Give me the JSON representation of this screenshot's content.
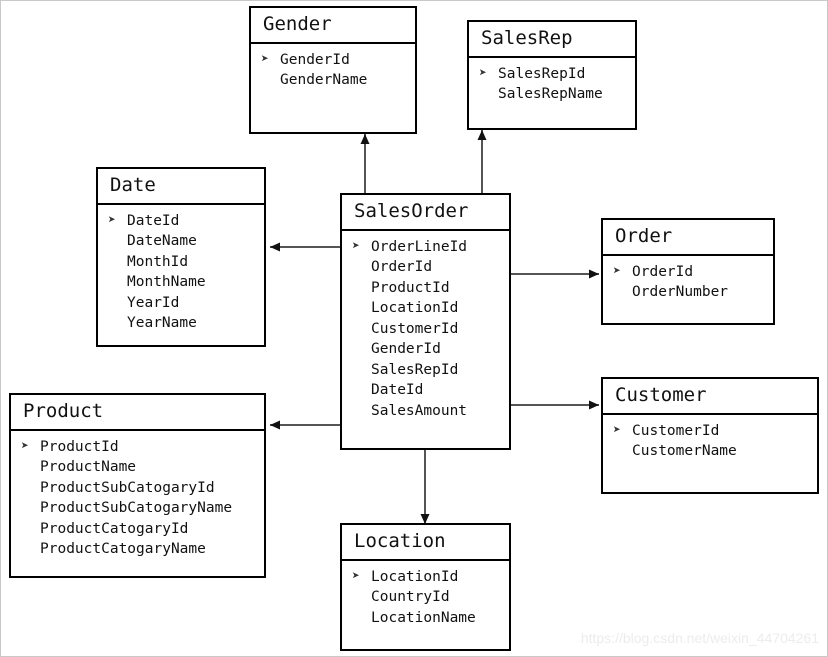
{
  "diagram": {
    "type": "star-schema-erd",
    "watermark": "https://blog.csdn.net/weixin_44704261",
    "pk_marker": "➤",
    "colors": {
      "box_border": "#000000",
      "background": "#ffffff",
      "text": "#111111",
      "connector": "#555555",
      "watermark": "#ececec",
      "frame": "#c9c9c9"
    },
    "entities": [
      {
        "id": "gender",
        "title": "Gender",
        "fields": [
          {
            "name": "GenderId",
            "pk": true
          },
          {
            "name": "GenderName",
            "pk": false
          }
        ]
      },
      {
        "id": "salesrep",
        "title": "SalesRep",
        "fields": [
          {
            "name": "SalesRepId",
            "pk": true
          },
          {
            "name": "SalesRepName",
            "pk": false
          }
        ]
      },
      {
        "id": "date",
        "title": "Date",
        "fields": [
          {
            "name": "DateId",
            "pk": true
          },
          {
            "name": "DateName",
            "pk": false
          },
          {
            "name": "MonthId",
            "pk": false
          },
          {
            "name": "MonthName",
            "pk": false
          },
          {
            "name": "YearId",
            "pk": false
          },
          {
            "name": "YearName",
            "pk": false
          }
        ]
      },
      {
        "id": "salesorder",
        "title": "SalesOrder",
        "fields": [
          {
            "name": "OrderLineId",
            "pk": true
          },
          {
            "name": "OrderId",
            "pk": false
          },
          {
            "name": "ProductId",
            "pk": false
          },
          {
            "name": "LocationId",
            "pk": false
          },
          {
            "name": "CustomerId",
            "pk": false
          },
          {
            "name": "GenderId",
            "pk": false
          },
          {
            "name": "SalesRepId",
            "pk": false
          },
          {
            "name": "DateId",
            "pk": false
          },
          {
            "name": "SalesAmount",
            "pk": false
          }
        ]
      },
      {
        "id": "order",
        "title": "Order",
        "fields": [
          {
            "name": "OrderId",
            "pk": true
          },
          {
            "name": "OrderNumber",
            "pk": false
          }
        ]
      },
      {
        "id": "customer",
        "title": "Customer",
        "fields": [
          {
            "name": "CustomerId",
            "pk": true
          },
          {
            "name": "CustomerName",
            "pk": false
          }
        ]
      },
      {
        "id": "product",
        "title": "Product",
        "fields": [
          {
            "name": "ProductId",
            "pk": true
          },
          {
            "name": "ProductName",
            "pk": false
          },
          {
            "name": "ProductSubCatogaryId",
            "pk": false
          },
          {
            "name": "ProductSubCatogaryName",
            "pk": false
          },
          {
            "name": "ProductCatogaryId",
            "pk": false
          },
          {
            "name": "ProductCatogaryName",
            "pk": false
          }
        ]
      },
      {
        "id": "location",
        "title": "Location",
        "fields": [
          {
            "name": "LocationId",
            "pk": true
          },
          {
            "name": "CountryId",
            "pk": false
          },
          {
            "name": "LocationName",
            "pk": false
          }
        ]
      }
    ],
    "relationships": [
      {
        "from": "salesorder",
        "to": "gender",
        "direction": "up"
      },
      {
        "from": "salesorder",
        "to": "salesrep",
        "direction": "up"
      },
      {
        "from": "salesorder",
        "to": "date",
        "direction": "left"
      },
      {
        "from": "salesorder",
        "to": "product",
        "direction": "left"
      },
      {
        "from": "salesorder",
        "to": "order",
        "direction": "right"
      },
      {
        "from": "salesorder",
        "to": "customer",
        "direction": "right"
      },
      {
        "from": "salesorder",
        "to": "location",
        "direction": "down"
      }
    ]
  }
}
